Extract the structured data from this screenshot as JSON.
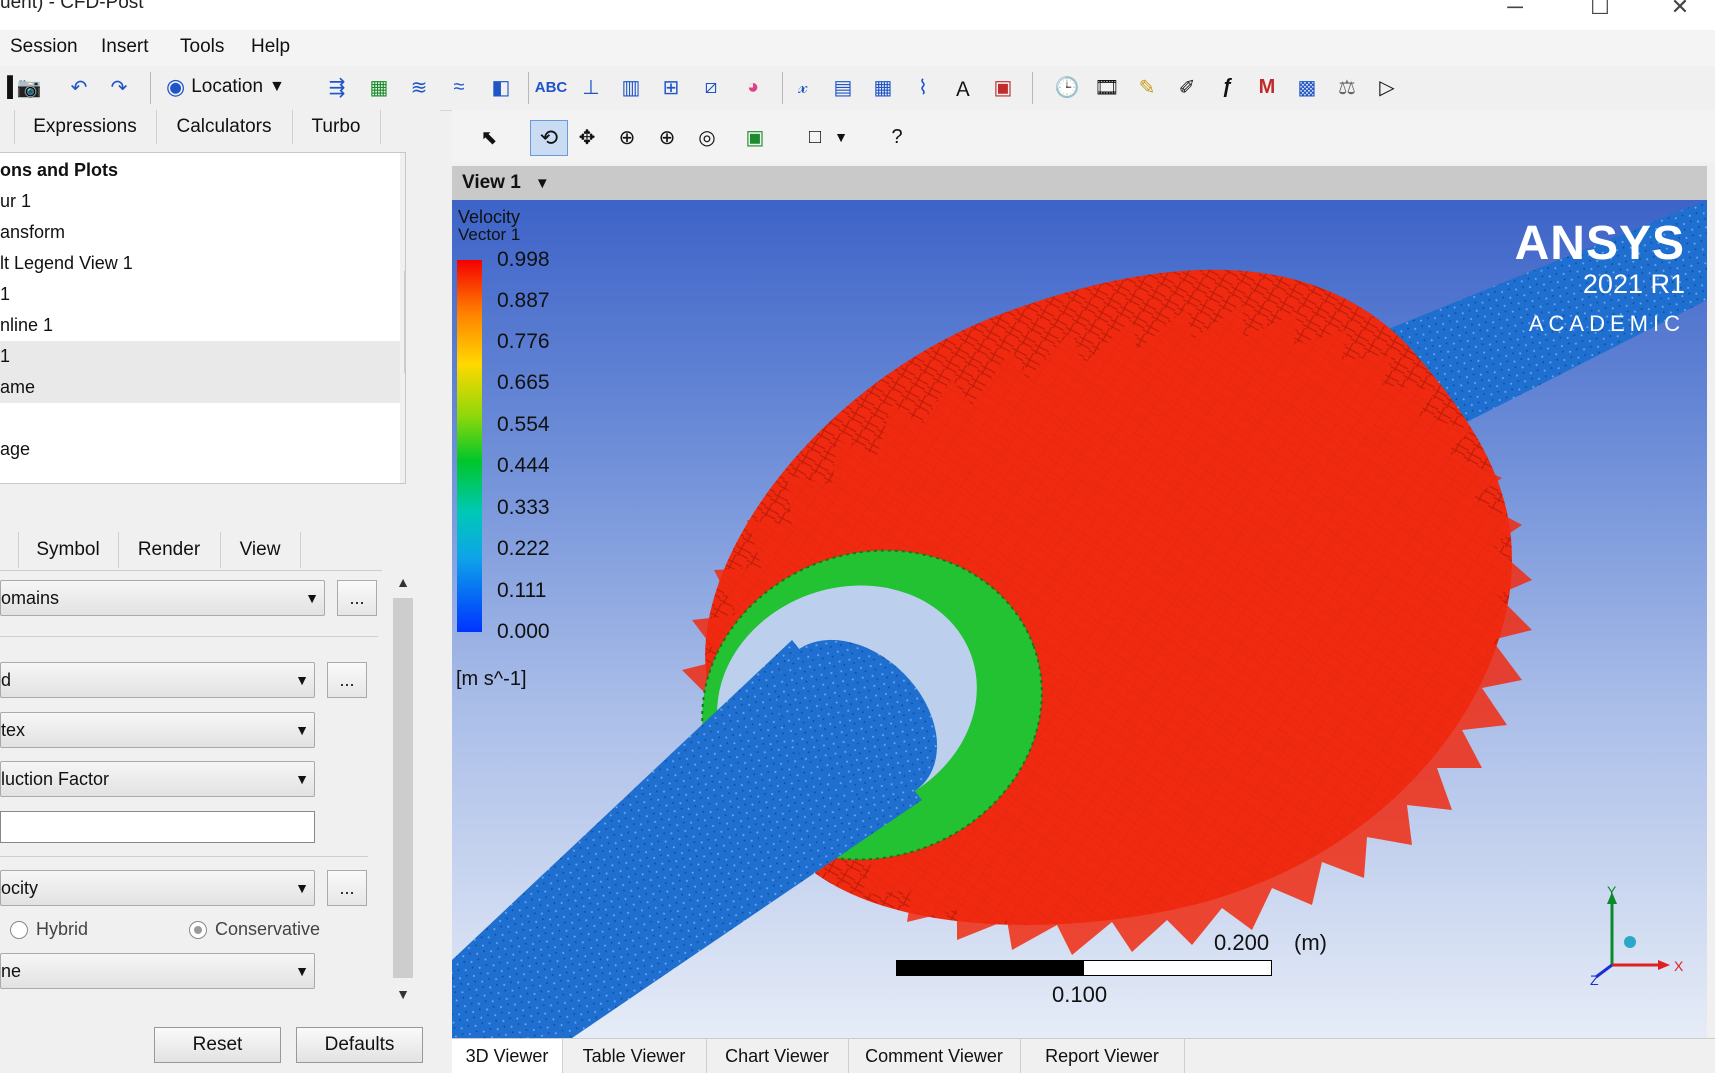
{
  "window": {
    "title": "uent) - CFD-Post"
  },
  "menu": [
    "Session",
    "Insert",
    "Tools",
    "Help"
  ],
  "toolbar": {
    "location_label": "Location"
  },
  "left_tabs": [
    "Expressions",
    "Calculators",
    "Turbo"
  ],
  "tree_items": [
    "ons and Plots",
    "ur 1",
    "ansform",
    "lt Legend View 1",
    "1",
    "nline 1",
    "1",
    "ame",
    "",
    "age"
  ],
  "detail_tabs": [
    "Symbol",
    "Render",
    "View"
  ],
  "details": {
    "domains": "omains",
    "locations": "d",
    "sampling": "tex",
    "reduction": "luction Factor",
    "reduction_value": "",
    "variable": "ocity",
    "radio_hybrid": "Hybrid",
    "radio_conservative": "Conservative",
    "boundary": "ne",
    "ellipsis": "..."
  },
  "buttons": {
    "reset": "Reset",
    "defaults": "Defaults"
  },
  "viewer": {
    "view_label": "View 1",
    "legend_title": "Velocity",
    "legend_subtitle": "Vector 1",
    "legend_values": [
      "0.998",
      "0.887",
      "0.776",
      "0.665",
      "0.554",
      "0.444",
      "0.333",
      "0.222",
      "0.111",
      "0.000"
    ],
    "legend_units": "[m s^-1]",
    "logo_brand": "ANSYS",
    "logo_version": "2021 R1",
    "logo_edition": "ACADEMIC",
    "scale_major": "0.200",
    "scale_unit": "(m)",
    "scale_minor": "0.100",
    "axis_x": "X",
    "axis_y": "Y",
    "axis_z": "Z"
  },
  "bottom_tabs": [
    "3D Viewer",
    "Table Viewer",
    "Chart Viewer",
    "Comment Viewer",
    "Report Viewer"
  ],
  "colors": {
    "arrow_red": "#f02a10",
    "arrow_green": "#23c233",
    "pipe_blue": "#1e6fcf"
  }
}
